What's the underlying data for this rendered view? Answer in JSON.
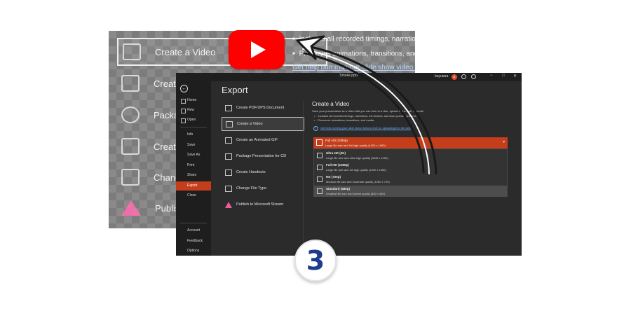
{
  "background_panel": {
    "items": [
      {
        "label": "Create a Video",
        "icon": "video-icon"
      },
      {
        "label": "Create an",
        "icon": "gif-icon"
      },
      {
        "label": "Package F",
        "icon": "cd-icon"
      },
      {
        "label": "Create Ha",
        "icon": "handouts-icon"
      },
      {
        "label": "Change F",
        "icon": "change-file-icon"
      },
      {
        "label": "Publish to",
        "icon": "stream-icon"
      }
    ],
    "bullets": [
      "Includes all recorded timings, narrations, ink",
      "Preserves animations, transitions, and media",
      "Get help burning your slide show video to"
    ]
  },
  "youtube": {
    "icon": "youtube-icon",
    "color": "#ff0000"
  },
  "window": {
    "title": "Smoke.pptx",
    "user": "bayutara",
    "avatar_initial": "B",
    "window_buttons": [
      "−",
      "□",
      "✕"
    ]
  },
  "sidebar": {
    "items": [
      "Home",
      "New",
      "Open",
      "Info",
      "Save",
      "Save As",
      "Print",
      "Share",
      "Export",
      "Close"
    ],
    "bottom": [
      "Account",
      "Feedback",
      "Options"
    ],
    "active": "Export"
  },
  "export": {
    "title": "Export",
    "options": [
      "Create PDF/XPS Document",
      "Create a Video",
      "Create an Animated GIF",
      "Package Presentation for CD",
      "Create Handouts",
      "Change File Type",
      "Publish to Microsoft Stream"
    ],
    "selected": "Create a Video"
  },
  "detail": {
    "title": "Create a Video",
    "description": "Save your presentation as a video that you can burn to a disc, upload to the web, or email",
    "bullets": [
      "Includes all recorded timings, narrations, ink strokes, and laser pointer gestures",
      "Preserves animations, transitions, and media"
    ],
    "help_link": "Get help burning your slide show video to DVD or uploading it to the web",
    "quality_selected": {
      "title": "Full HD (1080p)",
      "desc": "Large file size and full high quality (1920 x 1080)"
    },
    "quality_options": [
      {
        "title": "Ultra HD (4K)",
        "desc": "Large file size and ultra-high quality (3840 x 2160)"
      },
      {
        "title": "Full HD (1080p)",
        "desc": "Large file size and full high quality (1920 x 1080)"
      },
      {
        "title": "HD (720p)",
        "desc": "Medium file size and moderate quality (1280 x 720)"
      },
      {
        "title": "Standard (480p)",
        "desc": "Smallest file size and lowest quality (852 x 480)"
      }
    ]
  },
  "badge": {
    "number": "3"
  },
  "colors": {
    "accent": "#c43e1c",
    "window_bg": "#2b2b2b",
    "badge_text": "#1f3c8c"
  }
}
